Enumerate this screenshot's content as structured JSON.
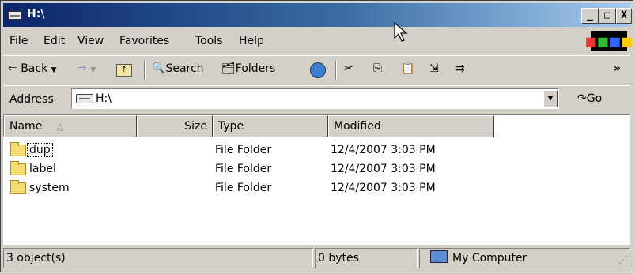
{
  "window": {
    "title": "H:\\"
  },
  "title_buttons": {
    "minimize": "_",
    "maximize": "□",
    "close": "X"
  },
  "menu": [
    "File",
    "Edit",
    "View",
    "Favorites",
    "Tools",
    "Help"
  ],
  "toolbar": {
    "back": "Back",
    "search": "Search",
    "folders": "Folders",
    "overflow": "»"
  },
  "address": {
    "label": "Address",
    "value": "H:\\",
    "go": "Go"
  },
  "columns": [
    "Name",
    "Size",
    "Type",
    "Modified"
  ],
  "files": [
    {
      "name": "dup",
      "size": "",
      "type": "File Folder",
      "modified": "12/4/2007 3:03 PM"
    },
    {
      "name": "label",
      "size": "",
      "type": "File Folder",
      "modified": "12/4/2007 3:03 PM"
    },
    {
      "name": "system",
      "size": "",
      "type": "File Folder",
      "modified": "12/4/2007 3:03 PM"
    }
  ],
  "status": {
    "objects": "3 object(s)",
    "size": "0 bytes",
    "zone": "My Computer"
  },
  "icons": [
    "drive-icon",
    "windows-logo-icon",
    "back-arrow-icon",
    "forward-arrow-icon",
    "up-folder-icon",
    "search-icon",
    "folders-icon",
    "history-icon",
    "cut-icon",
    "copy-icon",
    "paste-icon",
    "move-to-icon",
    "copy-to-icon",
    "go-arrow-icon",
    "folder-icon",
    "my-computer-icon",
    "sort-ascending-icon",
    "resize-grip-icon",
    "mouse-cursor-icon"
  ],
  "colors": {
    "titlebar_start": "#0a246a",
    "titlebar_end": "#a6caf0",
    "face": "#d4d0c8"
  }
}
